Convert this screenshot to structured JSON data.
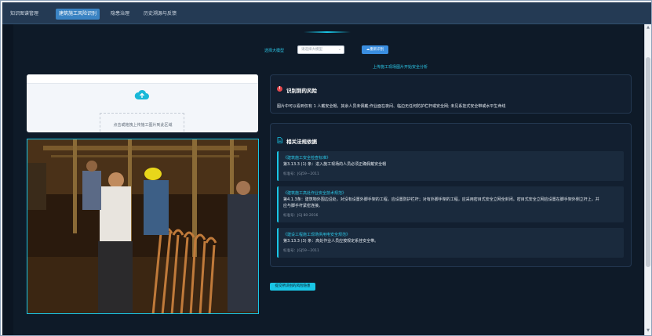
{
  "nav": {
    "items": [
      {
        "label": "知识图谱管理",
        "active": false
      },
      {
        "label": "建筑施工风险识别",
        "active": true
      },
      {
        "label": "隐患治理",
        "active": false
      },
      {
        "label": "历史溯源与反馈",
        "active": false
      }
    ]
  },
  "toolbar": {
    "model_label": "选择大模型",
    "model_placeholder": "请选择大模型",
    "refresh_label": "重新识别"
  },
  "upload": {
    "hint": "上传施工现场图片开始安全分析",
    "drop_label": "点击或拖拽上传施工图片到此区域"
  },
  "risk_panel": {
    "title": "识别到的风险",
    "text": "图片中可以看到仅有 1 人戴安全帽，其余人员未佩戴;作业面在夜间、临边无任何防护栏杆或安全网; 未见系挂式安全带或水平生命线"
  },
  "law_panel": {
    "title": "相关法规依据",
    "items": [
      {
        "title": "《建筑施工安全检查标准》",
        "lines": [
          "第3.13.3 (1) 条：进入施工现场的人员必须正确佩戴安全帽"
        ],
        "number": "标准号：JGJ59－2011"
      },
      {
        "title": "《建筑施工高处作业安全技术规范》",
        "lines": [
          "第4.1.3条：建筑物外围边沿处，对没有设置外脚手架的工程，应设置防护栏杆；对有外脚手架的工程，应采用密目式安全立网全封闭。密目式安全立网应设置在脚手架外侧立杆上，并",
          "应与脚手杆紧密连接。"
        ],
        "number": "标准号：JGJ 80-2016"
      },
      {
        "title": "《建设工程施工现场供用电安全规范》",
        "lines": [
          "第3.13.3 (3) 条：高处作业人员应按规定系挂安全带。"
        ],
        "number": "标准号：JGJ59－2011"
      }
    ]
  },
  "submit_label": "提交所识别的风险隐患",
  "colors": {
    "accent": "#19c6e6",
    "nav_active": "#3a83c3",
    "danger": "#e5484d",
    "background": "#0e1a28"
  }
}
